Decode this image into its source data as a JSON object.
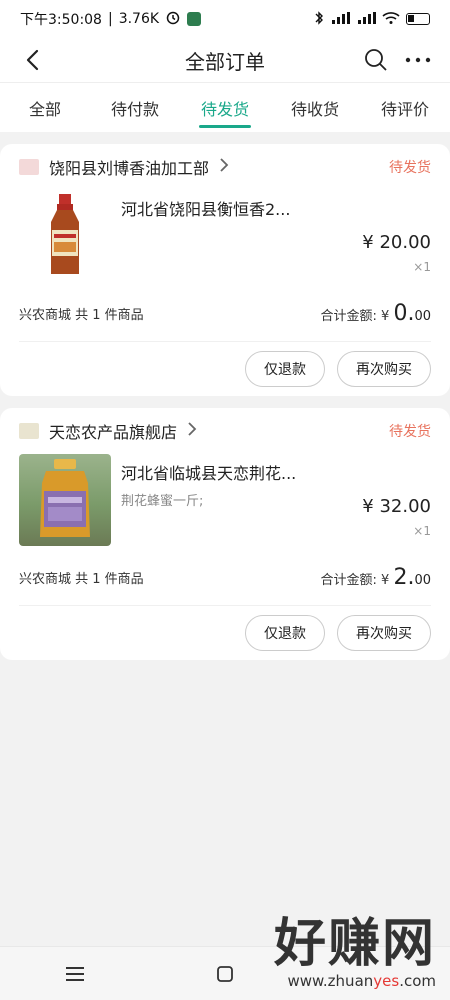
{
  "status_bar": {
    "time": "下午3:50:08",
    "net_speed": "3.76K",
    "separator": "|",
    "battery_level": 0.3
  },
  "header": {
    "title": "全部订单"
  },
  "tabs": [
    {
      "label": "全部"
    },
    {
      "label": "待付款"
    },
    {
      "label": "待发货"
    },
    {
      "label": "待收货"
    },
    {
      "label": "待评价"
    }
  ],
  "active_tab": "待发货",
  "orders": [
    {
      "shop_name": "饶阳县刘博香油加工部",
      "status": "待发货",
      "item_title": "河北省饶阳县衡恒香2...",
      "item_sub": "",
      "price": "¥ 20.00",
      "qty": "×1",
      "summary_left": "兴农商城 共 1 件商品",
      "total_label": "合计金额: ¥",
      "total_int": "0.",
      "total_dec": "00",
      "btn_refund": "仅退款",
      "btn_rebuy": "再次购买"
    },
    {
      "shop_name": "天恋农产品旗舰店",
      "status": "待发货",
      "item_title": "河北省临城县天恋荆花...",
      "item_sub": "荆花蜂蜜一斤;",
      "price": "¥ 32.00",
      "qty": "×1",
      "summary_left": "兴农商城 共 1 件商品",
      "total_label": "合计金额: ¥",
      "total_int": "2.",
      "total_dec": "00",
      "btn_refund": "仅退款",
      "btn_rebuy": "再次购买"
    }
  ],
  "watermark": {
    "big": "好赚网",
    "prefix": "www.zhuan",
    "accent": "yes",
    "suffix": ".com"
  },
  "colors": {
    "accent": "#1aa88a",
    "status": "#e8735e",
    "watermark_accent": "#e53935"
  }
}
